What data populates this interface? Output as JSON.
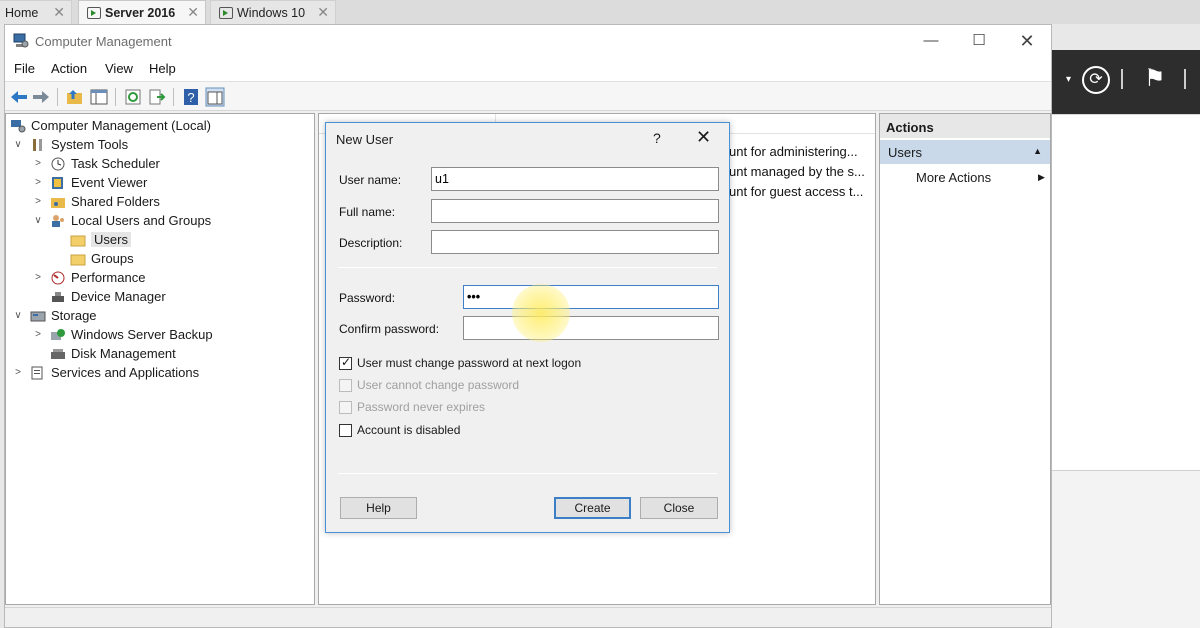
{
  "vm_tabs": [
    {
      "label": "Home"
    },
    {
      "label": "Server 2016"
    },
    {
      "label": "Windows 10"
    }
  ],
  "window": {
    "title": "Computer Management",
    "menu": [
      "File",
      "Action",
      "View",
      "Help"
    ]
  },
  "tree": [
    {
      "label": "Computer Management (Local)"
    },
    {
      "label": "System Tools"
    },
    {
      "label": "Task Scheduler"
    },
    {
      "label": "Event Viewer"
    },
    {
      "label": "Shared Folders"
    },
    {
      "label": "Local Users and Groups"
    },
    {
      "label": "Users"
    },
    {
      "label": "Groups"
    },
    {
      "label": "Performance"
    },
    {
      "label": "Device Manager"
    },
    {
      "label": "Storage"
    },
    {
      "label": "Windows Server Backup"
    },
    {
      "label": "Disk Management"
    },
    {
      "label": "Services and Applications"
    }
  ],
  "list_descriptions": [
    "unt for administering...",
    "unt managed by the s...",
    "unt for guest access t..."
  ],
  "actions": {
    "header": "Actions",
    "section": "Users",
    "more": "More Actions"
  },
  "dialog": {
    "title": "New User",
    "help_glyph": "?",
    "fields": {
      "username_label": "User name:",
      "username_value": "u1",
      "fullname_label": "Full name:",
      "fullname_value": "",
      "description_label": "Description:",
      "description_value": "",
      "password_label": "Password:",
      "password_value": "•••",
      "confirm_label": "Confirm password:",
      "confirm_value": ""
    },
    "options": [
      {
        "label": "User must change password at next logon",
        "checked": true,
        "enabled": true
      },
      {
        "label": "User cannot change password",
        "checked": false,
        "enabled": false
      },
      {
        "label": "Password never expires",
        "checked": false,
        "enabled": false
      },
      {
        "label": "Account is disabled",
        "checked": false,
        "enabled": true
      }
    ],
    "buttons": {
      "help": "Help",
      "create": "Create",
      "close": "Close"
    }
  },
  "colors": {
    "accent": "#3c7fc6",
    "selection": "#c9d9ea",
    "dark_bar": "#2d2d2d"
  }
}
